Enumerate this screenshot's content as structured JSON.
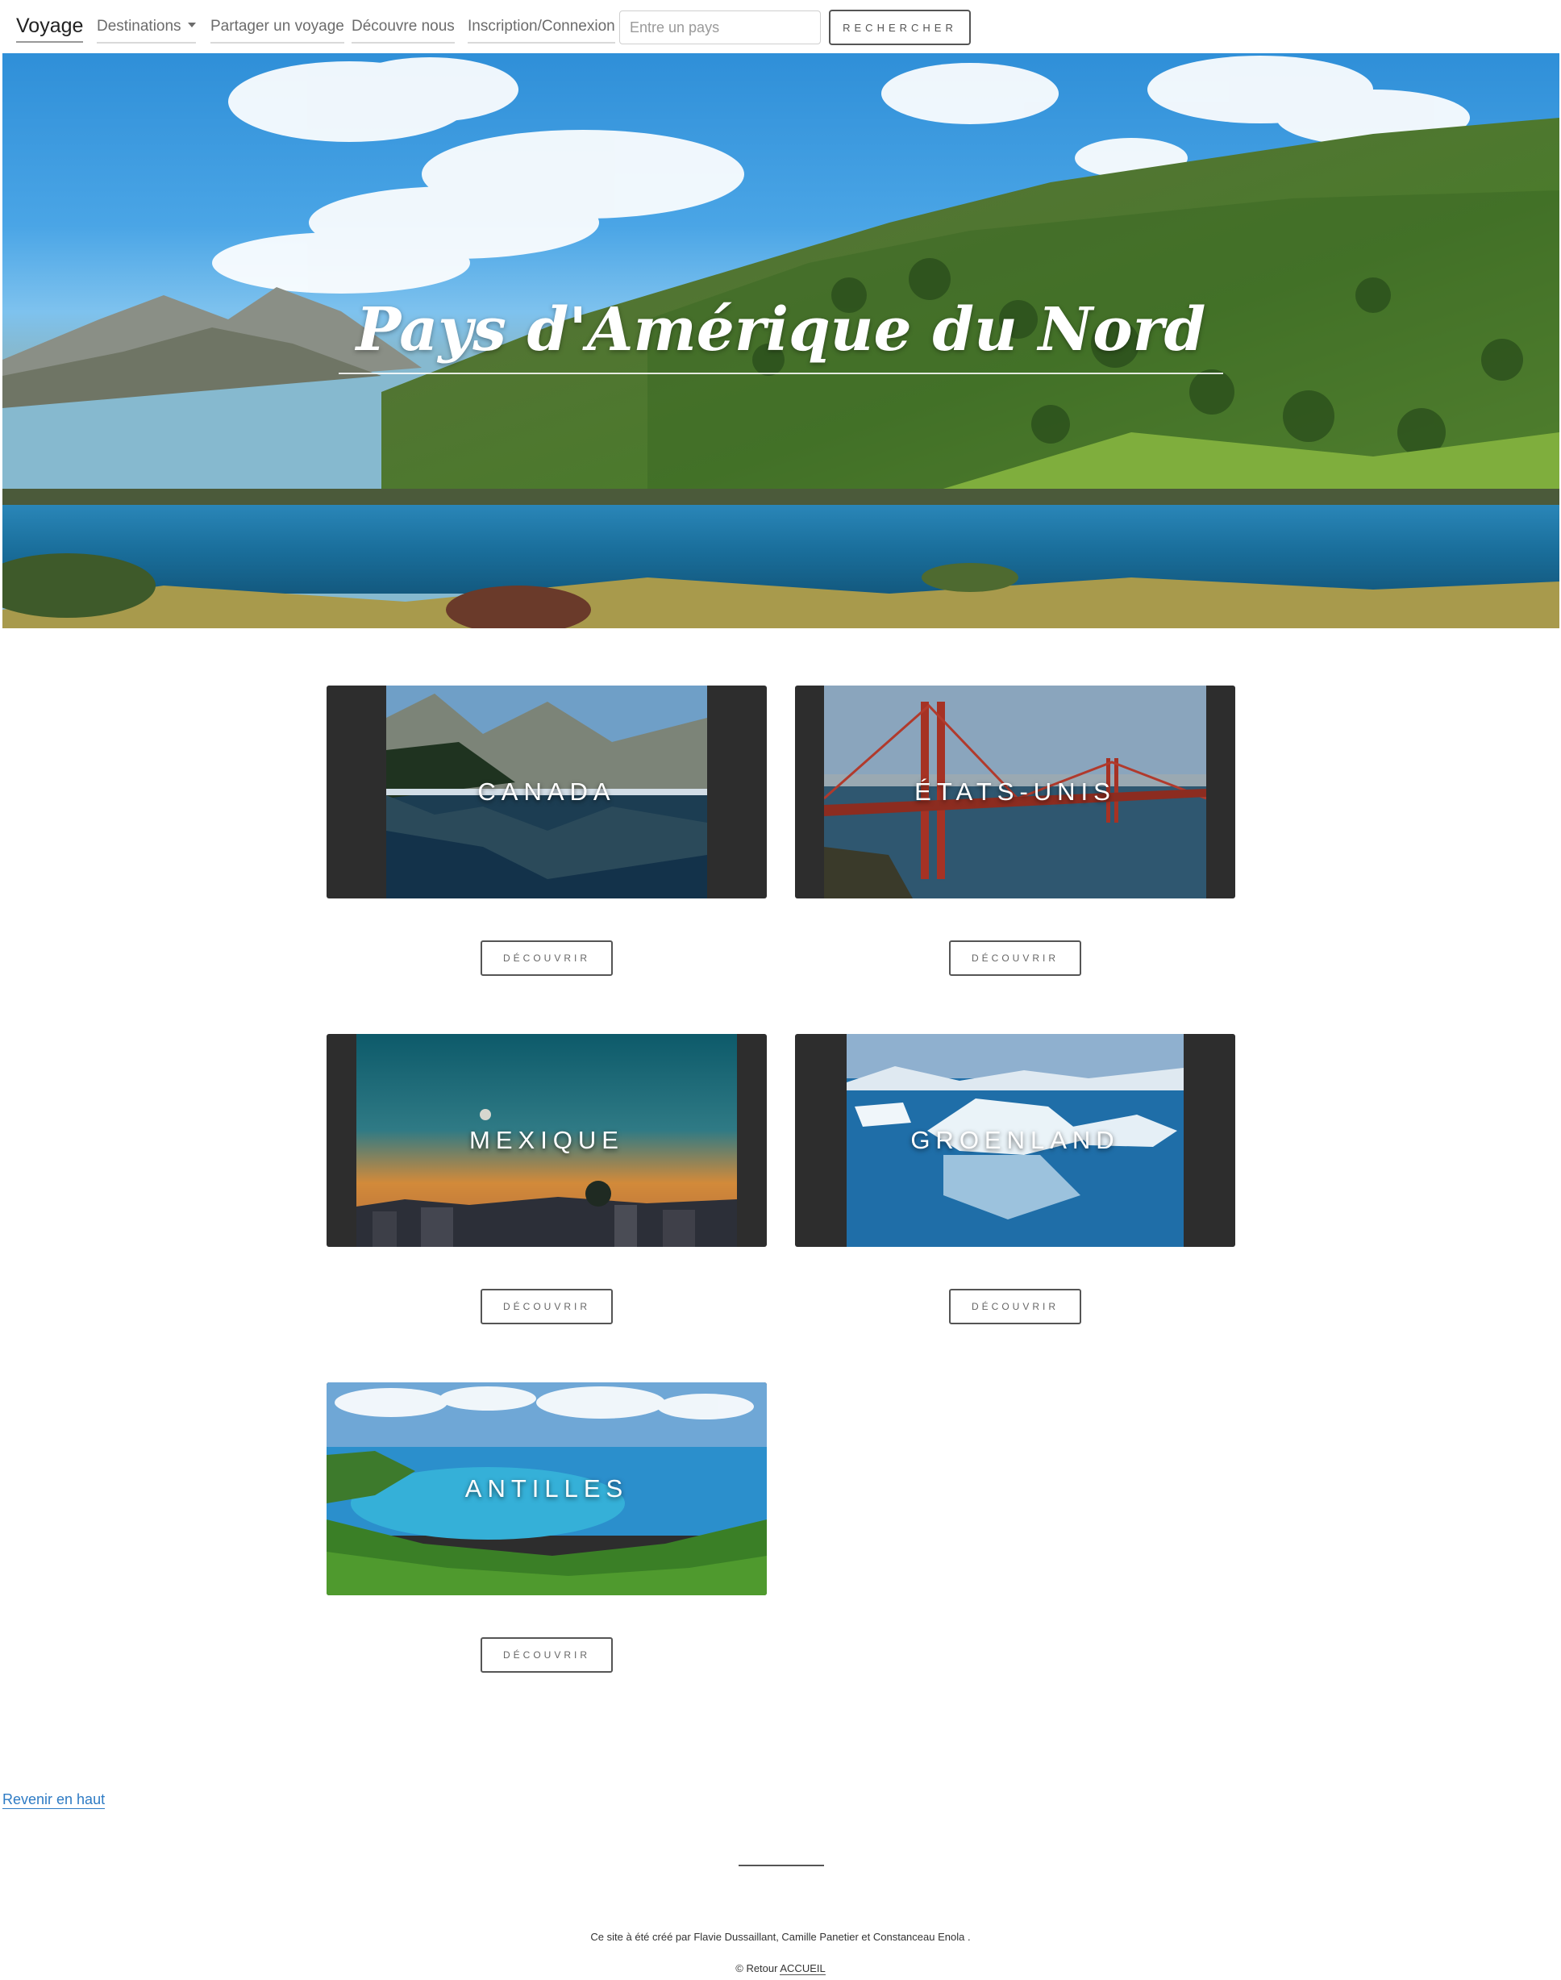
{
  "navbar": {
    "brand": "Voyage",
    "links": [
      {
        "label": "Destinations",
        "dropdown": true
      },
      {
        "label": "Partager un voyage"
      },
      {
        "label": "Découvre nous"
      },
      {
        "label": "Inscription/Connexion"
      }
    ],
    "search": {
      "placeholder": "Entre un pays",
      "value": ""
    },
    "search_button": "Rechercher"
  },
  "hero": {
    "title": "Pays d'Amérique du Nord"
  },
  "countries": [
    {
      "name": "Canada",
      "button": "Découvrir"
    },
    {
      "name": "États-Unis",
      "button": "Découvrir"
    },
    {
      "name": "Mexique",
      "button": "Découvrir"
    },
    {
      "name": "Groenland",
      "button": "Découvrir"
    },
    {
      "name": "Antilles",
      "button": "Découvrir"
    }
  ],
  "footer": {
    "back_to_top": "Revenir en haut",
    "credits": "Ce site à été créé par Flavie Dussaillant, Camille Panetier et Constanceau Enola .",
    "copyright_prefix": "© Retour",
    "home_link": "ACCUEIL"
  },
  "colors": {
    "card_background": "#2d2d2d",
    "link": "#2e7bc4",
    "button_border": "#555555"
  }
}
